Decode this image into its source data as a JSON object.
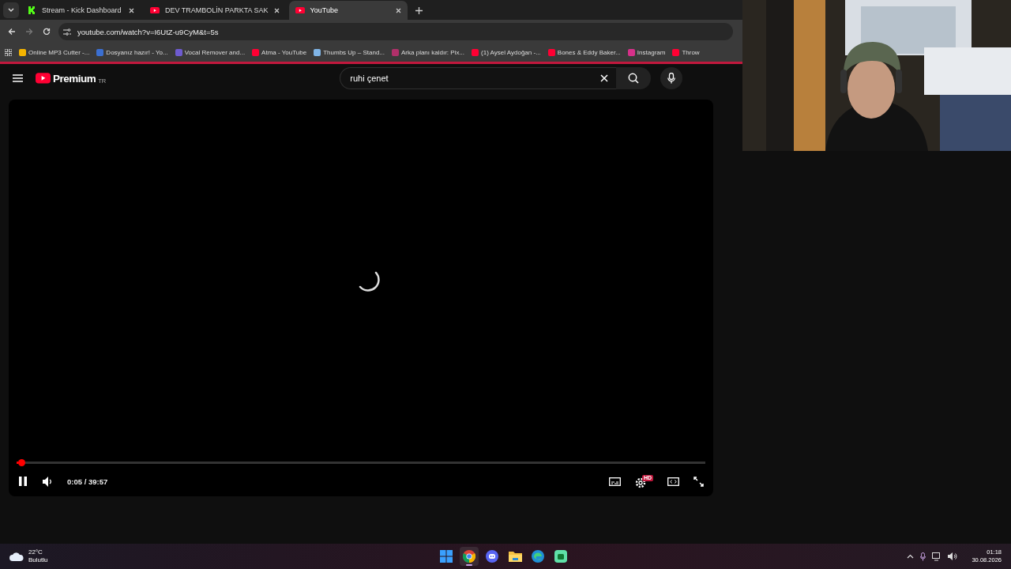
{
  "tabs": [
    {
      "title": "Stream - Kick Dashboard",
      "kind": "kick",
      "selected": false
    },
    {
      "title": "DEV TRAMBOLİN PARKTA SAK",
      "kind": "youtube",
      "selected": false
    },
    {
      "title": "YouTube",
      "kind": "youtube",
      "selected": true
    }
  ],
  "address_bar": {
    "url": "youtube.com/watch?v=I6UtZ-u9CyM&t=5s"
  },
  "bookmarks": [
    {
      "label": "Online MP3 Cutter -...",
      "color": "#f4b400"
    },
    {
      "label": "Dosyanız hazır! - Yo...",
      "color": "#3b6fd1"
    },
    {
      "label": "Vocal Remover and...",
      "color": "#6e5bd0"
    },
    {
      "label": "Atma - YouTube",
      "color": "#ff0033"
    },
    {
      "label": "Thumbs Up – Stand...",
      "color": "#7fb4e6"
    },
    {
      "label": "Arka planı kaldır: Pix...",
      "color": "#b0306a"
    },
    {
      "label": "(1) Aysel Aydoğan -...",
      "color": "#ff0033"
    },
    {
      "label": "Bones & Eddy Baker...",
      "color": "#ff0033"
    },
    {
      "label": "Instagram",
      "color": "#d6308a"
    },
    {
      "label": "Throw",
      "color": "#ff0033"
    }
  ],
  "youtube": {
    "logo": "Premium",
    "region": "TR",
    "search": {
      "value": "ruhi çenet"
    }
  },
  "player": {
    "progress": {
      "level": 0.002
    },
    "playing": true,
    "time": "0:05 / 39:57",
    "quality_badge": "HD"
  },
  "taskbar": {
    "weather": {
      "temp": "22°C",
      "condition": "Bulutlu"
    },
    "apps": [
      {
        "kind": "start",
        "active": false
      },
      {
        "kind": "chrome",
        "active": true
      },
      {
        "kind": "discord",
        "active": false
      },
      {
        "kind": "folder",
        "active": false
      },
      {
        "kind": "edge",
        "active": false
      },
      {
        "kind": "app",
        "active": false
      }
    ],
    "time": "01:18",
    "date": "30.08.2026"
  }
}
